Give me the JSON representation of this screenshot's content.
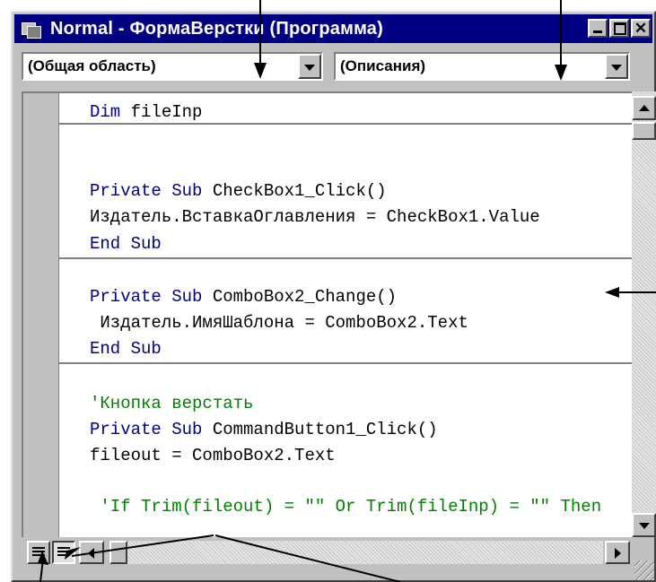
{
  "window": {
    "title": "Normal - ФормаВерстки (Программа)",
    "close_glyph": "✕"
  },
  "toolbar": {
    "object_combo": {
      "value": "(Общая область)"
    },
    "procedure_combo": {
      "value": "(Описания)"
    }
  },
  "code": {
    "lines": [
      {
        "parts": [
          {
            "text": "Dim ",
            "style": "kw"
          },
          {
            "text": "fileInp",
            "style": "plain"
          }
        ]
      },
      {
        "parts": [
          {
            "text": "Private Sub ",
            "style": "kw"
          },
          {
            "text": "CheckBox1_Click()",
            "style": "plain"
          }
        ]
      },
      {
        "parts": [
          {
            "text": "Издатель.ВставкаОглавления = CheckBox1.Value",
            "style": "plain"
          }
        ]
      },
      {
        "parts": [
          {
            "text": "End Sub",
            "style": "kw"
          }
        ]
      },
      {
        "parts": [
          {
            "text": "Private Sub ",
            "style": "kw"
          },
          {
            "text": "ComboBox2_Change()",
            "style": "plain"
          }
        ]
      },
      {
        "parts": [
          {
            "text": " Издатель.ИмяШаблона = ComboBox2.Text",
            "style": "plain"
          }
        ]
      },
      {
        "parts": [
          {
            "text": "End Sub",
            "style": "kw"
          }
        ]
      },
      {
        "parts": [
          {
            "text": "'Кнопка верстать",
            "style": "cm"
          }
        ]
      },
      {
        "parts": [
          {
            "text": "Private Sub ",
            "style": "kw"
          },
          {
            "text": "CommandButton1_Click()",
            "style": "plain"
          }
        ]
      },
      {
        "parts": [
          {
            "text": "fileout = ComboBox2.Text",
            "style": "plain"
          }
        ]
      },
      {
        "parts": [
          {
            "text": " 'If Trim(fileout) = \"\" Or Trim(fileInp) = \"\" Then",
            "style": "cm"
          }
        ]
      }
    ]
  },
  "icons": {
    "window_icon": "vba-module-icon",
    "procedure_view": "procedure-view-icon",
    "full_module_view": "full-module-view-icon"
  },
  "colors": {
    "title_bar": "#000080",
    "keyword": "#000080",
    "comment": "#008000",
    "face": "#c0c0c0"
  }
}
